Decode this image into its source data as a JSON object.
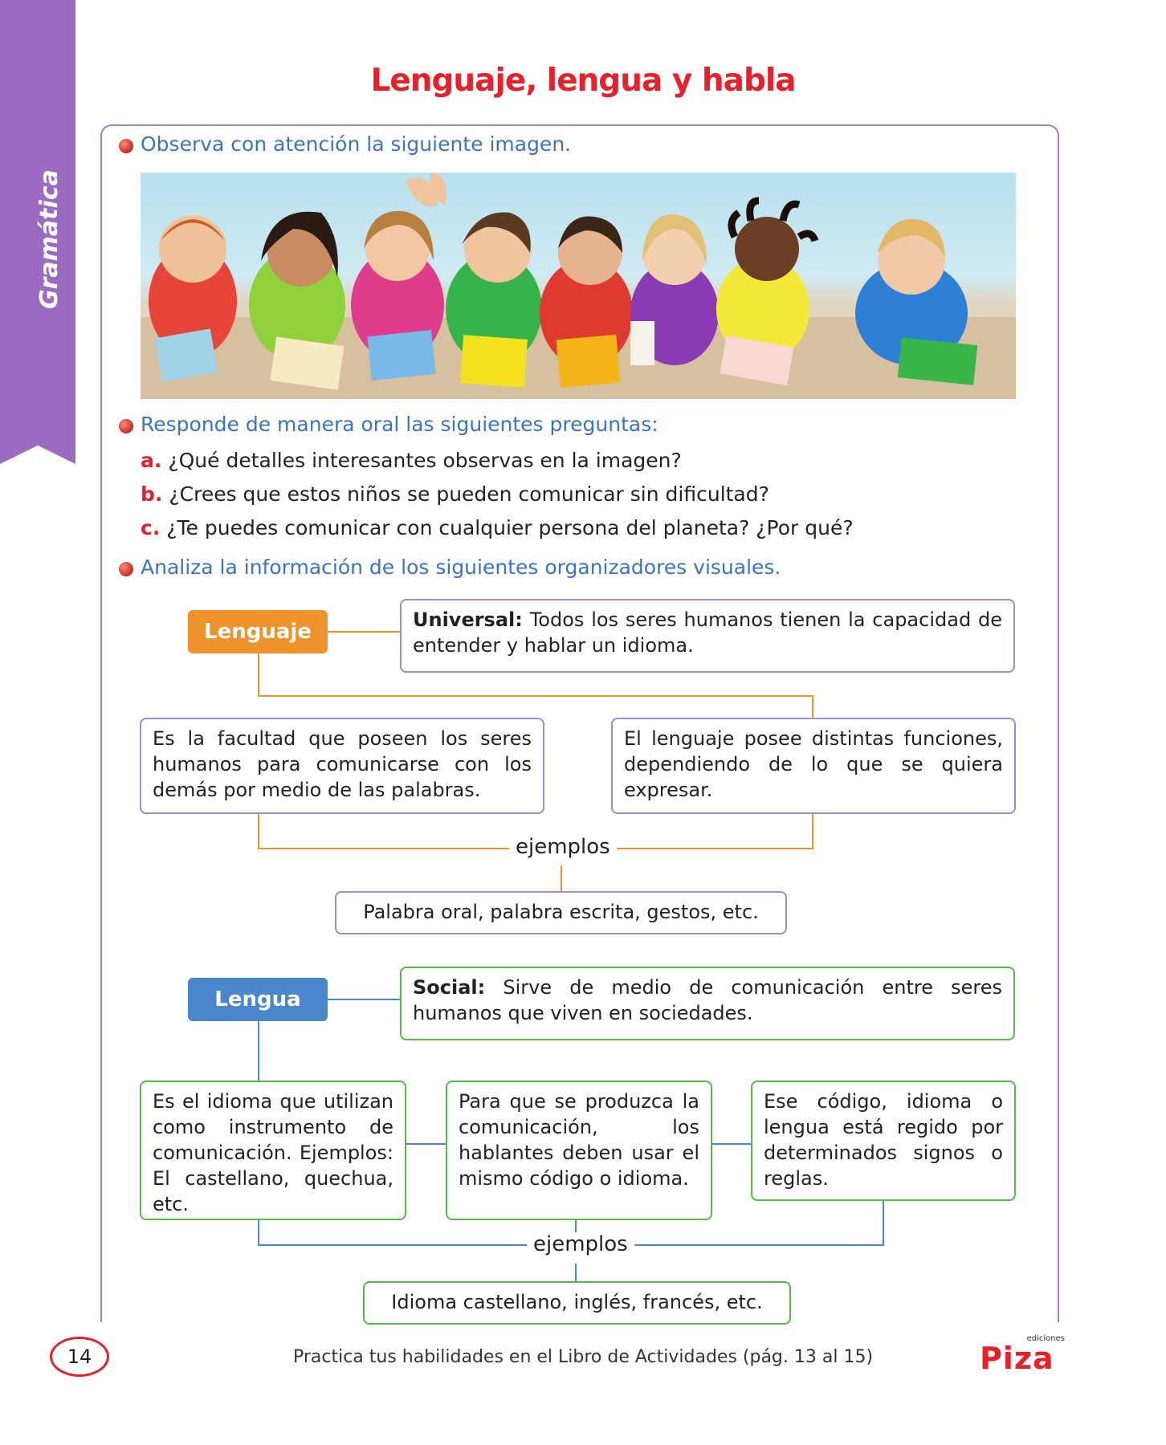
{
  "side_tab": {
    "label": "Gramática"
  },
  "title": "Lenguaje, lengua y habla",
  "instructions": [
    "Observa con atención la siguiente imagen.",
    "Responde de manera oral las siguientes preguntas:",
    "Analiza la información de los siguientes organizadores visuales."
  ],
  "questions": [
    {
      "letter": "a.",
      "text": "¿Qué detalles interesantes observas en la imagen?"
    },
    {
      "letter": "b.",
      "text": "¿Crees que estos niños se pueden comunicar sin dificultad?"
    },
    {
      "letter": "c.",
      "text": "¿Te puedes comunicar con cualquier persona del planeta? ¿Por qué?"
    }
  ],
  "lenguaje_map": {
    "node": "Lenguaje",
    "universal_label": "Universal:",
    "universal_text": " Todos los seres humanos tienen la capacidad de entender  y hablar un idioma.",
    "box_left": "Es la facultad que poseen los seres humanos para comunicarse con los demás  por medio de las palabras.",
    "box_right": "El lenguaje posee distintas funciones, dependiendo de lo que se quiera expresar.",
    "examples_label": "ejemplos",
    "examples": "Palabra oral, palabra escrita, gestos, etc."
  },
  "lengua_map": {
    "node": "Lengua",
    "social_label": "Social:",
    "social_text": " Sirve de medio de comunicación entre seres humanos que viven en sociedades.",
    "box_1": "Es el idioma que utilizan como instrumento de comunicación. Ejemplos: El castellano, quechua, etc.",
    "box_2": "Para que se produzca la comunicación, los hablantes deben usar el mismo código o idioma.",
    "box_3": "Ese código, idioma o lengua está regido por determinados signos o reglas.",
    "examples_label": "ejemplos",
    "examples": "Idioma castellano, inglés, francés, etc."
  },
  "footer": {
    "page_number": "14",
    "text": "Practica tus habilidades en el Libro de Actividades (pág. 13 al 15)",
    "logo_small": "ediciones",
    "logo": "Piza"
  },
  "colors": {
    "title": "#e8202a",
    "instruction": "#3a73c4",
    "side_tab": "#9b6bc1",
    "lenguaje_node": "#f0922c",
    "lengua_node": "#4a86cc"
  }
}
